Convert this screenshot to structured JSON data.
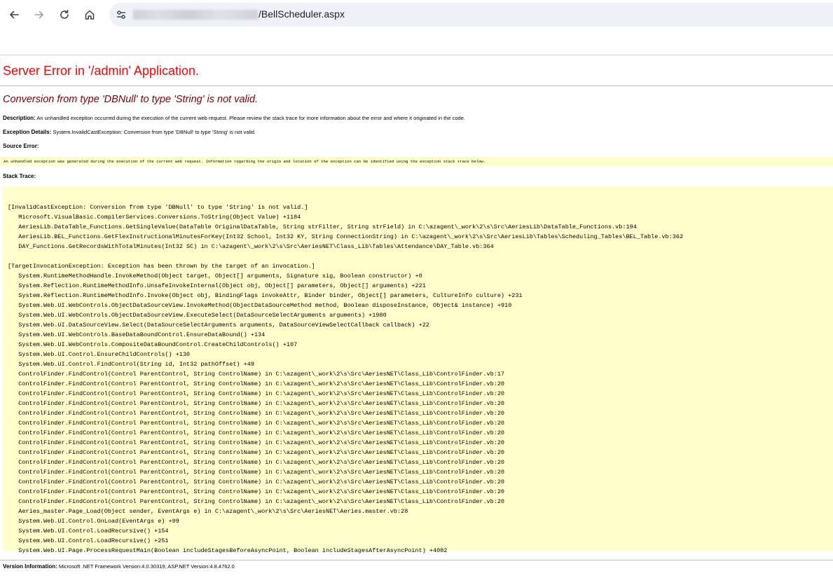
{
  "browser": {
    "url_path": "/BellScheduler.aspx",
    "icons": [
      "back-arrow-icon",
      "forward-arrow-icon",
      "reload-icon",
      "home-icon",
      "site-info-icon"
    ]
  },
  "page": {
    "title": "Server Error in '/admin' Application.",
    "error_message": "Conversion from type 'DBNull' to type 'String' is not valid.",
    "description_label": "Description:",
    "description_text": " An unhandled exception occurred during the execution of the current web request. Please review the stack trace for more information about the error and where it originated in the code.",
    "exception_label": "Exception Details:",
    "exception_text": " System.InvalidCastException: Conversion from type 'DBNull' to type 'String' is not valid.",
    "source_error_label": "Source Error:",
    "source_error_text": "An unhandled exception was generated during the execution of the current web request. Information regarding the origin and location of the exception can be identified using the exception stack trace below.",
    "stack_trace_label": "Stack Trace:",
    "stack_trace": "[InvalidCastException: Conversion from type 'DBNull' to type 'String' is not valid.]\n   Microsoft.VisualBasic.CompilerServices.Conversions.ToString(Object Value) +1184\n   AeriesLib.DataTable_Functions.GetSingleValue(DataTable OriginalDataTable, String strFilter, String strField) in C:\\azagent\\_work\\2\\s\\Src\\AeriesLib\\DataTable_Functions.vb:194\n   AeriesLib.BEL_Functions.GetFlexInstructionalMinutesForKey(Int32 School, Int32 KY, String ConnectionString) in C:\\azagent\\_work\\2\\s\\Src\\AeriesLib\\Tables\\Scheduling_Tables\\BEL_Table.vb:362\n   DAY_Functions.GetRecordsWithTotalMinutes(Int32 SC) in C:\\azagent\\_work\\2\\s\\Src\\AeriesNET\\Class_Lib\\Tables\\Attendance\\DAY_Table.vb:364\n\n[TargetInvocationException: Exception has been thrown by the target of an invocation.]\n   System.RuntimeMethodHandle.InvokeMethod(Object target, Object[] arguments, Signature sig, Boolean constructor) +0\n   System.Reflection.RuntimeMethodInfo.UnsafeInvokeInternal(Object obj, Object[] parameters, Object[] arguments) +221\n   System.Reflection.RuntimeMethodInfo.Invoke(Object obj, BindingFlags invokeAttr, Binder binder, Object[] parameters, CultureInfo culture) +231\n   System.Web.UI.WebControls.ObjectDataSourceView.InvokeMethod(ObjectDataSourceMethod method, Boolean disposeInstance, Object& instance) +910\n   System.Web.UI.WebControls.ObjectDataSourceView.ExecuteSelect(DataSourceSelectArguments arguments) +1980\n   System.Web.UI.DataSourceView.Select(DataSourceSelectArguments arguments, DataSourceViewSelectCallback callback) +22\n   System.Web.UI.WebControls.BaseDataBoundControl.EnsureDataBound() +134\n   System.Web.UI.WebControls.CompositeDataBoundControl.CreateChildControls() +107\n   System.Web.UI.Control.EnsureChildControls() +130\n   System.Web.UI.Control.FindControl(String id, Int32 pathOffset) +49\n   ControlFinder.FindControl(Control ParentControl, String ControlName) in C:\\azagent\\_work\\2\\s\\Src\\AeriesNET\\Class_Lib\\ControlFinder.vb:17\n   ControlFinder.FindControl(Control ParentControl, String ControlName) in C:\\azagent\\_work\\2\\s\\Src\\AeriesNET\\Class_Lib\\ControlFinder.vb:20\n   ControlFinder.FindControl(Control ParentControl, String ControlName) in C:\\azagent\\_work\\2\\s\\Src\\AeriesNET\\Class_Lib\\ControlFinder.vb:20\n   ControlFinder.FindControl(Control ParentControl, String ControlName) in C:\\azagent\\_work\\2\\s\\Src\\AeriesNET\\Class_Lib\\ControlFinder.vb:20\n   ControlFinder.FindControl(Control ParentControl, String ControlName) in C:\\azagent\\_work\\2\\s\\Src\\AeriesNET\\Class_Lib\\ControlFinder.vb:20\n   ControlFinder.FindControl(Control ParentControl, String ControlName) in C:\\azagent\\_work\\2\\s\\Src\\AeriesNET\\Class_Lib\\ControlFinder.vb:20\n   ControlFinder.FindControl(Control ParentControl, String ControlName) in C:\\azagent\\_work\\2\\s\\Src\\AeriesNET\\Class_Lib\\ControlFinder.vb:20\n   ControlFinder.FindControl(Control ParentControl, String ControlName) in C:\\azagent\\_work\\2\\s\\Src\\AeriesNET\\Class_Lib\\ControlFinder.vb:20\n   ControlFinder.FindControl(Control ParentControl, String ControlName) in C:\\azagent\\_work\\2\\s\\Src\\AeriesNET\\Class_Lib\\ControlFinder.vb:20\n   ControlFinder.FindControl(Control ParentControl, String ControlName) in C:\\azagent\\_work\\2\\s\\Src\\AeriesNET\\Class_Lib\\ControlFinder.vb:20\n   ControlFinder.FindControl(Control ParentControl, String ControlName) in C:\\azagent\\_work\\2\\s\\Src\\AeriesNET\\Class_Lib\\ControlFinder.vb:20\n   ControlFinder.FindControl(Control ParentControl, String ControlName) in C:\\azagent\\_work\\2\\s\\Src\\AeriesNET\\Class_Lib\\ControlFinder.vb:20\n   ControlFinder.FindControl(Control ParentControl, String ControlName) in C:\\azagent\\_work\\2\\s\\Src\\AeriesNET\\Class_Lib\\ControlFinder.vb:20\n   ControlFinder.FindControl(Control ParentControl, String ControlName) in C:\\azagent\\_work\\2\\s\\Src\\AeriesNET\\Class_Lib\\ControlFinder.vb:20\n   Aeries_master.Page_Load(Object sender, EventArgs e) in C:\\azagent\\_work\\2\\s\\Src\\AeriesNET\\Aeries.master.vb:28\n   System.Web.UI.Control.OnLoad(EventArgs e) +99\n   System.Web.UI.Control.LoadRecursive() +154\n   System.Web.UI.Control.LoadRecursive() +251\n   System.Web.UI.Page.ProcessRequestMain(Boolean includeStagesBeforeAsyncPoint, Boolean includeStagesAfterAsyncPoint) +4082",
    "version_label": "Version Information:",
    "version_text": " Microsoft .NET Framework Version:4.0.30319; ASP.NET Version:4.8.4762.0"
  },
  "colors": {
    "title": "#ff0000",
    "error_message": "#800000",
    "code_background": "#ffffcc",
    "omnibox": "#eef1f8"
  }
}
